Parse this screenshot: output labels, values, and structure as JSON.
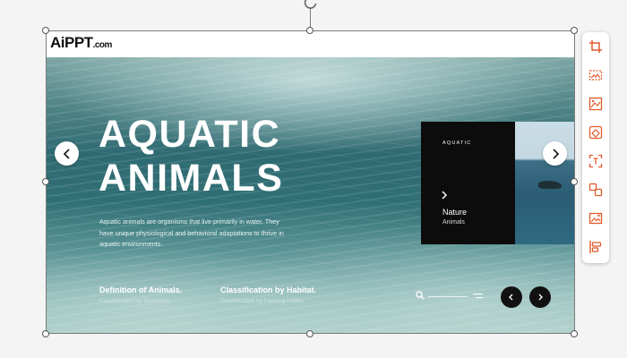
{
  "logo": {
    "ai": "AiPPT",
    "com": ".com"
  },
  "slide": {
    "title_line1": "AQUATIC",
    "title_line2": "ANIMALS",
    "description": "Aquatic animals are organisms that live primarily in water. They have unique physiological and behavioral adaptations to thrive in aquatic environments.",
    "info_left": {
      "heading": "Definition of Animals.",
      "sub": "Classification by Taxonomy."
    },
    "info_right": {
      "heading": "Classification by Habitat.",
      "sub": "Classification by Feeding Habits."
    },
    "card": {
      "tag": "AQUATIC",
      "line1": "Nature",
      "line2": "Animals"
    }
  },
  "icons": {
    "rotate": "rotate-icon",
    "toolbar": [
      "crop-icon",
      "replace-image-icon",
      "image-adjust-icon",
      "remove-background-icon",
      "ocr-text-icon",
      "swap-icon",
      "image-edit-icon",
      "align-layout-icon"
    ]
  },
  "colors": {
    "accent": "#e05a2b",
    "slide_card": "#0c0c0c"
  }
}
